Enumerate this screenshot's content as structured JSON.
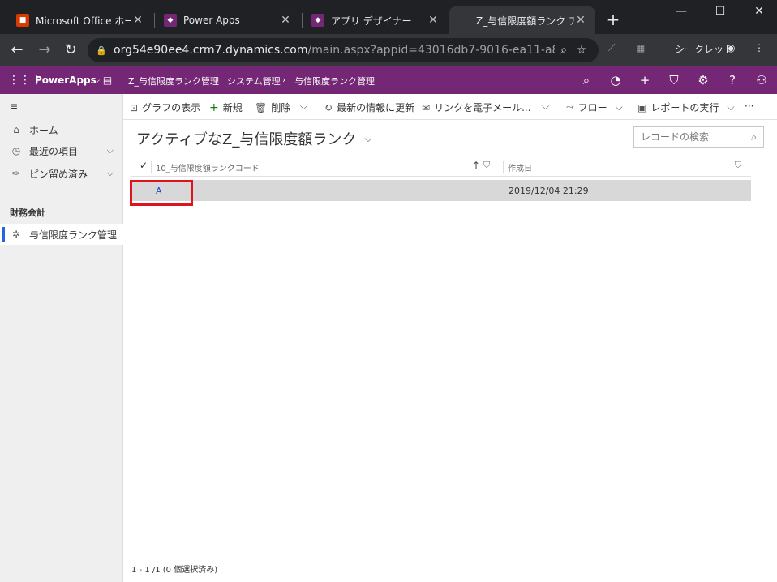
{
  "browser": {
    "tabs": [
      {
        "title": "Microsoft Office ホーム",
        "favicon": "office-icon",
        "color": "#d83b01"
      },
      {
        "title": "Power Apps",
        "favicon": "powerapps-icon",
        "color": "#742774"
      },
      {
        "title": "アプリ デザイナー",
        "favicon": "powerapps-icon",
        "color": "#742774"
      },
      {
        "title": "Z_与信限度額ランク アク",
        "favicon": "microsoft-icon",
        "color": "#f25022",
        "active": true
      }
    ],
    "url_host": "org54e90ee4.crm7.dynamics.com",
    "url_path": "/main.aspx?appid=43016db7-9016-ea11-a811-0...",
    "incognito_label": "シークレット"
  },
  "appbar": {
    "app_name": "PowerApps",
    "crumb_entity": "Z_与信限度ランク管理",
    "crumb_area": "システム管理",
    "crumb_page": "与信限度ランク管理",
    "bg_color": "#742774"
  },
  "sidebar": {
    "items": [
      {
        "label": "ホーム",
        "icon": "home-icon"
      },
      {
        "label": "最近の項目",
        "icon": "clock-icon"
      },
      {
        "label": "ピン留め済み",
        "icon": "pin-icon"
      }
    ],
    "group": "財務会計",
    "group_items": [
      {
        "label": "与信限度ランク管理",
        "icon": "puzzle-icon",
        "selected": true
      }
    ]
  },
  "commands": {
    "chart": "グラフの表示",
    "new": "新規",
    "delete": "削除",
    "refresh": "最新の情報に更新",
    "email_link": "リンクを電子メール...",
    "flow": "フロー",
    "report": "レポートの実行"
  },
  "view": {
    "title": "アクティブなZ_与信限度額ランク",
    "search_placeholder": "レコードの検索",
    "columns": [
      "10_与信限度額ランクコード",
      "作成日"
    ],
    "rows": [
      {
        "code": "A",
        "created": "2019/12/04 21:29"
      }
    ],
    "status": "1 - 1 /1 (0 個選択済み)"
  }
}
